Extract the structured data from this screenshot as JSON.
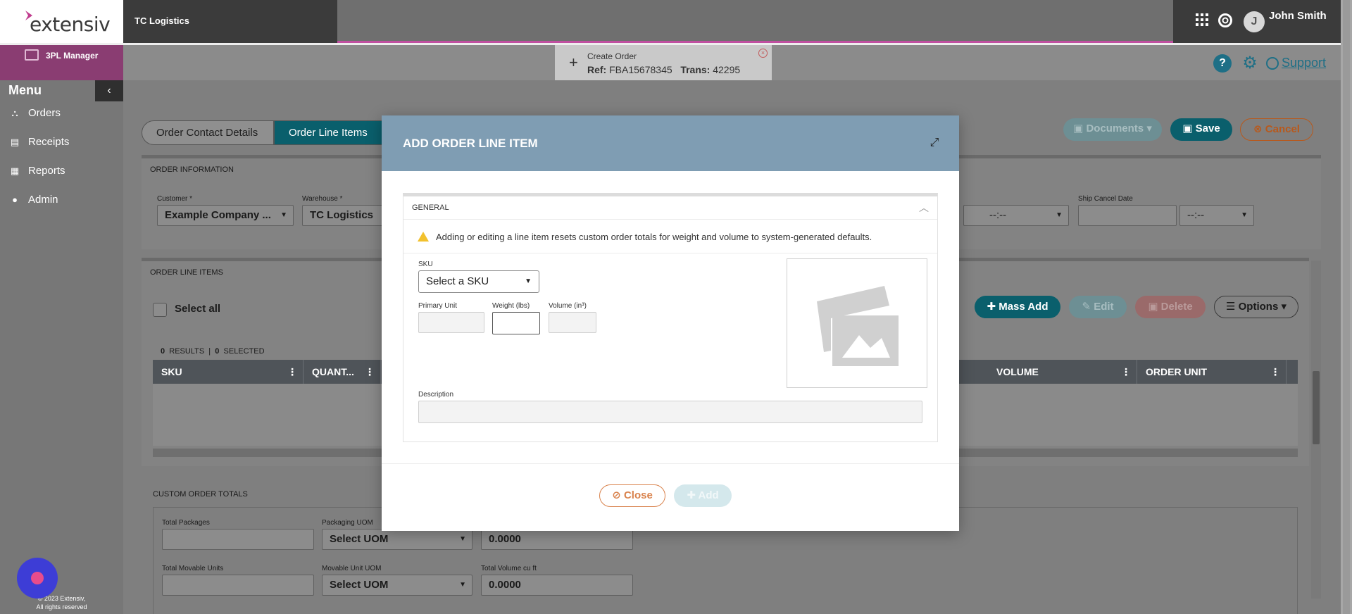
{
  "header": {
    "logo_text": "extensiv",
    "company": "TC Logistics",
    "user_initial": "J",
    "user_name": "John Smith"
  },
  "subbar": {
    "app_label": "3PL Manager",
    "order_tab": {
      "title": "Create Order",
      "ref_label": "Ref:",
      "ref_value": "FBA15678345",
      "trans_label": "Trans:",
      "trans_value": "42295"
    },
    "support_label": "Support"
  },
  "sidebar": {
    "menu_label": "Menu",
    "items": [
      {
        "label": "Orders",
        "icon": "sitemap-icon"
      },
      {
        "label": "Receipts",
        "icon": "document-icon"
      },
      {
        "label": "Reports",
        "icon": "report-icon"
      },
      {
        "label": "Admin",
        "icon": "user-icon"
      }
    ],
    "copyright_line1": "© 2023 Extensiv,",
    "copyright_line2": "All rights reserved"
  },
  "tabs": [
    {
      "label": "Order Contact Details"
    },
    {
      "label": "Order Line Items"
    }
  ],
  "actions": {
    "documents": "Documents",
    "save": "Save",
    "cancel": "Cancel"
  },
  "order_info": {
    "title": "ORDER INFORMATION",
    "customer_label": "Customer *",
    "customer_value": "Example Company ...",
    "warehouse_label": "Warehouse *",
    "warehouse_value": "TC Logistics",
    "ship_cancel_label": "Ship Cancel Date",
    "time_placeholder": "--:--"
  },
  "line_items": {
    "title": "ORDER LINE ITEMS",
    "select_all": "Select all",
    "results_count": "0",
    "results_label": "RESULTS",
    "selected_count": "0",
    "selected_label": "SELECTED",
    "mass_add": "Mass Add",
    "edit": "Edit",
    "delete": "Delete",
    "options": "Options",
    "columns": [
      "SKU",
      "QUANT...",
      "VOLUME",
      "ORDER UNIT"
    ]
  },
  "custom_totals": {
    "title": "CUSTOM ORDER TOTALS",
    "total_packages_label": "Total Packages",
    "packaging_uom_label": "Packaging UOM",
    "packaging_uom_value": "Select UOM",
    "weight_value": "0.0000",
    "total_movable_label": "Total Movable Units",
    "movable_uom_label": "Movable Unit UOM",
    "movable_uom_value": "Select UOM",
    "total_volume_label": "Total Volume cu ft",
    "volume_value": "0.0000"
  },
  "modal": {
    "title": "ADD ORDER LINE ITEM",
    "section_title": "GENERAL",
    "warning": "Adding or editing a line item resets custom order totals for weight and volume to system-generated defaults.",
    "sku_label": "SKU",
    "sku_placeholder": "Select a SKU",
    "primary_unit_label": "Primary Unit",
    "weight_label": "Weight (lbs)",
    "volume_label": "Volume (in³)",
    "description_label": "Description",
    "close_label": "Close",
    "add_label": "Add"
  }
}
